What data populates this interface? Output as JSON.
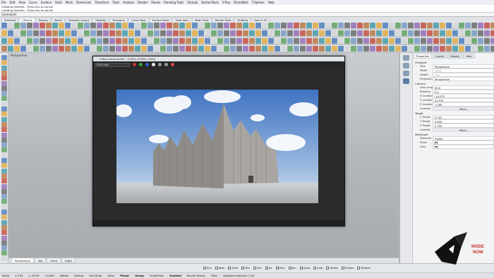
{
  "menu": [
    "File",
    "Edit",
    "View",
    "Curve",
    "Surface",
    "Solid",
    "Mesh",
    "Dimension",
    "Transform",
    "Tools",
    "Analyze",
    "Render",
    "Panels",
    "Paneling Tools",
    "SimLab",
    "SectionTools",
    "V-Ray",
    "RhinoNest",
    "T-Splines",
    "Help"
  ],
  "command_history": [
    "Creating meshes... Press Esc to cancel",
    "Creating meshes... Press Esc to cancel"
  ],
  "command_prompt": "Command:",
  "toolbar_tabs": [
    "Standard",
    "CPlanes",
    "Display",
    "Select",
    "Viewport Layout",
    "Visibility",
    "Transform",
    "Curve Tools",
    "Surface Tools",
    "Solid Tools",
    "Mesh Tools",
    "Render Tools",
    "Drafting",
    "New in V5"
  ],
  "viewport_title": "Perspective",
  "xray": {
    "title": "V-Ray frame buffer - [100% of 800 x 450]",
    "channel": "RGB color"
  },
  "viewport_tabs": [
    "Perspective",
    "Top",
    "Front",
    "Right"
  ],
  "osnaps": [
    "End",
    "Near",
    "Point",
    "Mid",
    "Cen",
    "Int",
    "Perp",
    "Tan",
    "Quad",
    "Knot",
    "Vertex",
    "Project",
    "Disable"
  ],
  "status": {
    "world": "World",
    "x": "x 5.93",
    "y": "y -35.93",
    "z": "z 0.000",
    "units": "Meters",
    "layer": "Default",
    "grid_snap": "Grid Snap",
    "ortho": "Ortho",
    "planar": "Planar",
    "osnap": "Osnap",
    "smarttrack": "SmartTrack",
    "gumball": "Gumball",
    "record_history": "Record History",
    "filter": "Filter",
    "tolerance": "Absolute tolerance: 0.01"
  },
  "panel_tabs": [
    "Properties",
    "Layers",
    "Display",
    "Help"
  ],
  "properties": {
    "viewport_header": "Viewport",
    "title_label": "Title",
    "title_value": "Perspective",
    "width_label": "Width",
    "width_value": "1593",
    "height_label": "Height",
    "height_value": "799",
    "projection_label": "Projection",
    "projection_value": "Perspective",
    "camera_header": "Camera",
    "lens_label": "Lens Length",
    "lens_value": "50.0",
    "rotation_label": "Rotation",
    "rotation_value": "0.0",
    "xloc_label": "X Location",
    "xloc_value": "-14.275",
    "yloc_label": "Y Location",
    "yloc_value": "22.970",
    "zloc_label": "Z Location",
    "zloc_value": "7.189",
    "location_label": "Location",
    "place_label": "Place...",
    "target_header": "Target",
    "xt_label": "X Target",
    "xt_value": "9.702",
    "yt_label": "Y Target",
    "yt_value": "5.890",
    "zt_label": "Z Target",
    "zt_value": "9.702",
    "tloc_label": "Location",
    "tplace_label": "Place...",
    "wallpaper_header": "Wallpaper",
    "filename_label": "Filename",
    "filename_value": "(none)",
    "show_label": "Show",
    "gray_label": "Gray"
  },
  "logo_text": "MODE NOW",
  "colors": {
    "accent": "#2f6fc0",
    "menubar": "#eceff3",
    "render_sky": "#4d7fc4"
  }
}
